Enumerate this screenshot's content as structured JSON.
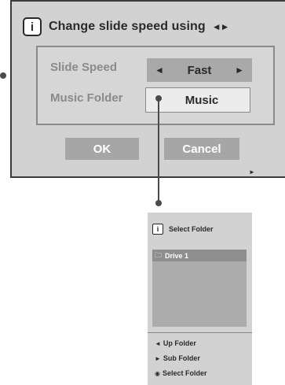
{
  "dialog": {
    "title": "Change slide speed using",
    "title_icon": "lr-arrows-icon",
    "info_glyph": "i",
    "rows": [
      {
        "label": "Slide Speed",
        "value": "Fast",
        "left_arrow": "◄",
        "right_arrow": "►"
      },
      {
        "label": "Music Folder",
        "value": "Music"
      }
    ],
    "ok_label": "OK",
    "cancel_label": "Cancel"
  },
  "folder_panel": {
    "title": "Select Folder",
    "info_glyph": "i",
    "items": [
      {
        "label": "Drive 1",
        "selected": true
      }
    ],
    "nav": [
      {
        "glyph": "◄",
        "label": "Up Folder"
      },
      {
        "glyph": "►",
        "label": "Sub Folder"
      },
      {
        "glyph": "◉",
        "label": "Select Folder"
      }
    ]
  },
  "colors": {
    "dialog_bg": "#d2d2d2",
    "button_bg": "#a6a6a6",
    "highlight_row": "#8e8e8e"
  }
}
